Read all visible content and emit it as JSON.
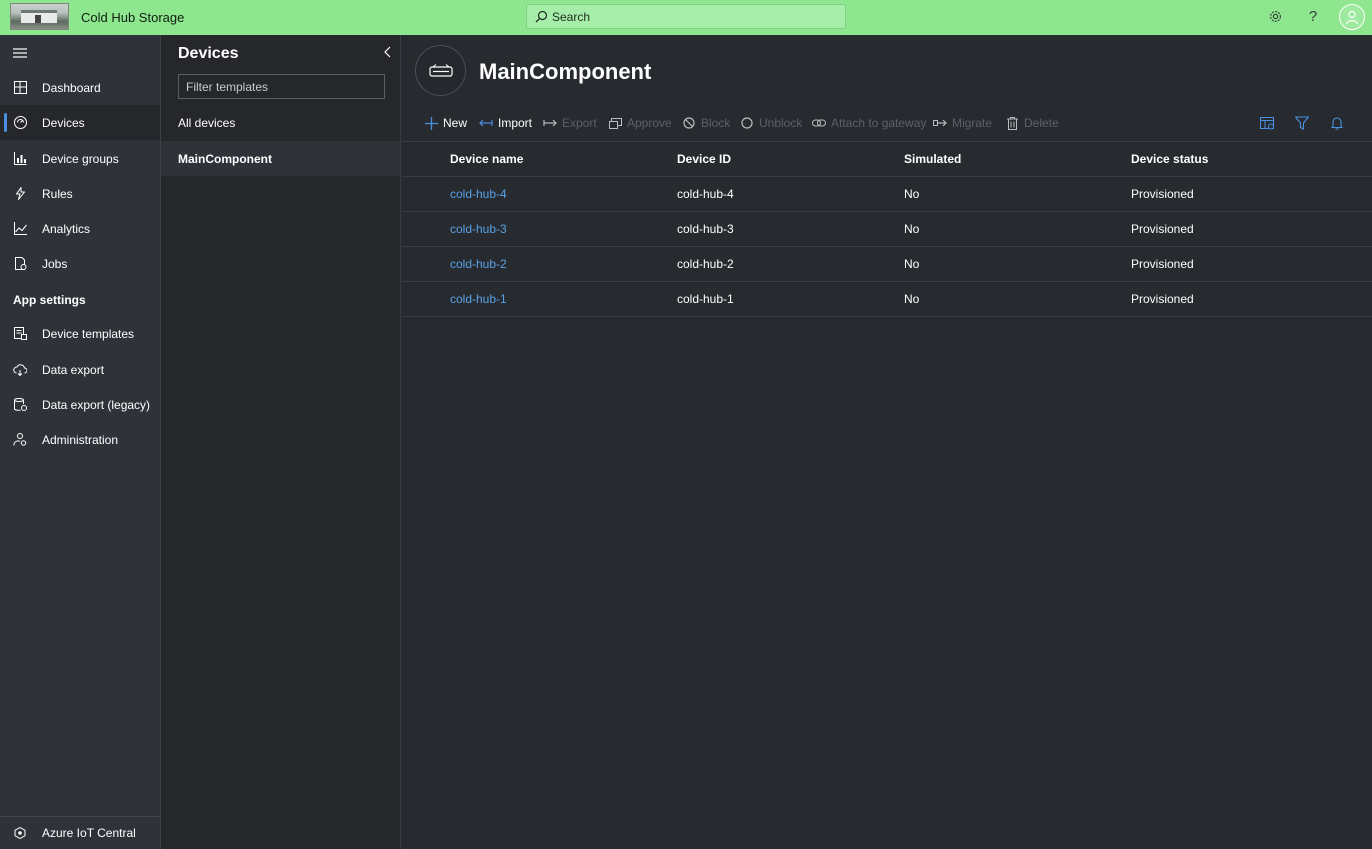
{
  "topbar": {
    "app_title": "Cold Hub Storage",
    "search_placeholder": "Search",
    "icons": [
      "settings-gear-icon",
      "help-icon",
      "user-avatar-icon"
    ],
    "accent_color": "#8ee68f"
  },
  "nav": {
    "items": [
      {
        "label": "Dashboard",
        "icon": "dashboard-icon"
      },
      {
        "label": "Devices",
        "icon": "devices-icon",
        "active": true
      },
      {
        "label": "Device groups",
        "icon": "device-groups-icon"
      },
      {
        "label": "Rules",
        "icon": "rules-icon"
      },
      {
        "label": "Analytics",
        "icon": "analytics-icon"
      },
      {
        "label": "Jobs",
        "icon": "jobs-icon"
      }
    ],
    "section_title": "App settings",
    "settings_items": [
      {
        "label": "Device templates",
        "icon": "device-templates-icon"
      },
      {
        "label": "Data export",
        "icon": "data-export-icon"
      },
      {
        "label": "Data export (legacy)",
        "icon": "data-export-legacy-icon"
      },
      {
        "label": "Administration",
        "icon": "administration-icon"
      }
    ],
    "footer_label": "Azure IoT Central",
    "active_color": "#4a90e2"
  },
  "devices_panel": {
    "title": "Devices",
    "filter_placeholder": "Filter templates",
    "templates": [
      {
        "label": "All devices"
      },
      {
        "label": "MainComponent",
        "selected": true
      }
    ]
  },
  "main": {
    "title": "MainComponent",
    "toolbar": {
      "new": "New",
      "import": "Import",
      "export": "Export",
      "approve": "Approve",
      "block": "Block",
      "unblock": "Unblock",
      "attach": "Attach to gateway",
      "migrate": "Migrate",
      "delete": "Delete"
    },
    "table": {
      "columns": [
        "Device name",
        "Device ID",
        "Simulated",
        "Device status"
      ],
      "rows": [
        {
          "name": "cold-hub-4",
          "id": "cold-hub-4",
          "simulated": "No",
          "status": "Provisioned"
        },
        {
          "name": "cold-hub-3",
          "id": "cold-hub-3",
          "simulated": "No",
          "status": "Provisioned"
        },
        {
          "name": "cold-hub-2",
          "id": "cold-hub-2",
          "simulated": "No",
          "status": "Provisioned"
        },
        {
          "name": "cold-hub-1",
          "id": "cold-hub-1",
          "simulated": "No",
          "status": "Provisioned"
        }
      ]
    },
    "link_color": "#5aa2e8"
  }
}
